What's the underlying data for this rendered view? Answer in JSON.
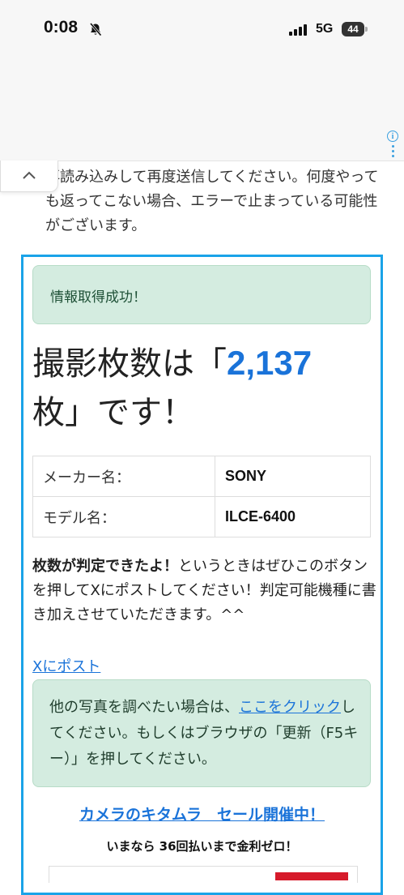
{
  "status_bar": {
    "time": "0:08",
    "network": "5G",
    "battery": "44"
  },
  "intro": {
    "text": "再読み込みして再度送信してください。何度やっても返ってこない場合、エラーで止まっている可能性がございます。"
  },
  "result": {
    "success_message": "情報取得成功！",
    "headline_prefix": "撮影枚数は「",
    "shot_count": "2,137",
    "headline_suffix": "枚」です！",
    "table": [
      {
        "label": "メーカー名：",
        "value": "SONY"
      },
      {
        "label": "モデル名：",
        "value": "ILCE-6400"
      }
    ],
    "note_bold": "枚数が判定できたよ！",
    "note_text": "というときはぜひこのボタンを押してXにポストしてください！判定可能機種に書き加えさせていただきます。^^",
    "post_link": "Xにポスト",
    "other_prefix": "他の写真を調べたい場合は、",
    "other_link": "ここをクリック",
    "other_suffix": "してください。もしくはブラウザの「更新（F5キー）」を押してください。"
  },
  "promo": {
    "link": "カメラのキタムラ　セール開催中！",
    "sub": "いまなら 36回払いまで金利ゼロ！"
  },
  "colors": {
    "accent": "#1a73d9",
    "frame": "#1aa3e8",
    "alert_bg": "#d4ece0"
  }
}
